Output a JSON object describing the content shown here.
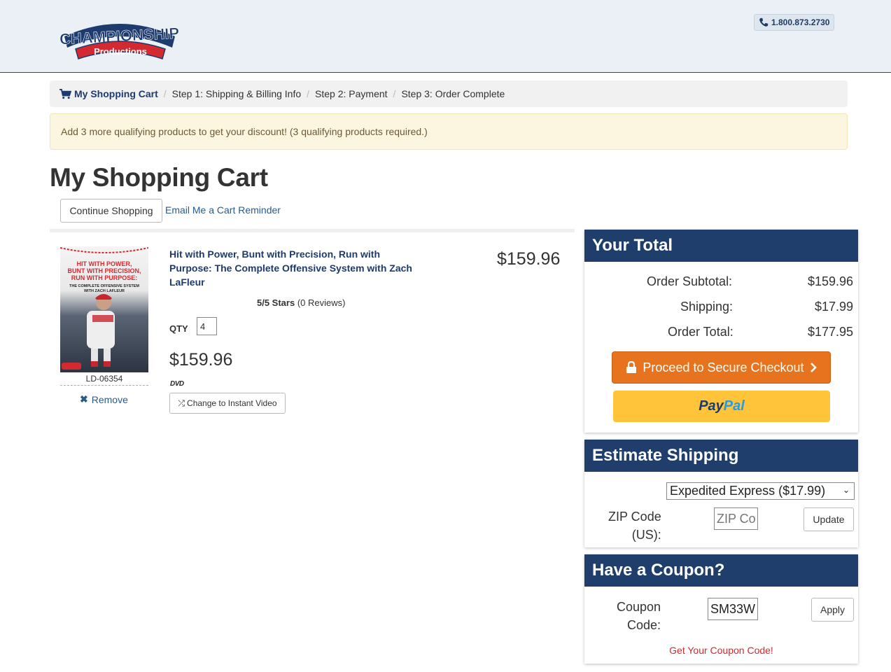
{
  "header": {
    "logo_top": "CHAMPIONSHIP",
    "logo_bottom": "Productions",
    "phone": "1.800.873.2730"
  },
  "breadcrumb": {
    "cart": "My Shopping Cart",
    "step1": "Step 1: Shipping & Billing Info",
    "step2": "Step 2: Payment",
    "step3": "Step 3: Order Complete"
  },
  "alert": "Add 3 more qualifying products to get your discount! (3 qualifying products required.)",
  "page_title": "My Shopping Cart",
  "actions": {
    "continue": "Continue Shopping",
    "email": "Email Me a Cart Reminder"
  },
  "item": {
    "cover_lines": [
      "HIT WITH POWER,",
      "BUNT WITH PRECISION,",
      "RUN WITH PURPOSE:",
      "THE COMPLETE OFFENSIVE SYSTEM",
      "WITH ZACH LAFLEUR"
    ],
    "sku": "LD-06354",
    "remove": "Remove",
    "title": "Hit with Power, Bunt with Precision, Run with Purpose: The Complete Offensive System with Zach LaFleur",
    "price_total": "$159.96",
    "stars_bold": "5/5 Stars",
    "stars_reviews": "(0 Reviews)",
    "qty_label": "QTY",
    "qty": "4",
    "price": "$159.96",
    "format": "DVD",
    "change_label": "Change to Instant Video"
  },
  "total": {
    "heading": "Your Total",
    "subtotal_label": "Order Subtotal:",
    "subtotal": "$159.96",
    "shipping_label": "Shipping:",
    "shipping": "$17.99",
    "order_total_label": "Order Total:",
    "order_total": "$177.95",
    "checkout_label": "Proceed to Secure Checkout",
    "paypal_a": "Pay",
    "paypal_b": "Pal"
  },
  "shipping": {
    "heading": "Estimate Shipping",
    "selected": "Expedited Express ($17.99)",
    "zip_label_1": "ZIP Code",
    "zip_label_2": "(US):",
    "zip_placeholder": "ZIP Co",
    "update": "Update"
  },
  "coupon": {
    "heading": "Have a Coupon?",
    "label_1": "Coupon",
    "label_2": "Code:",
    "value": "SM33W",
    "apply": "Apply",
    "link": "Get Your Coupon Code!"
  },
  "colors": {
    "navy": "#1f3e6b",
    "checkout": "#e8731e",
    "paypal": "#ffc43a",
    "link_red": "#d6262e"
  }
}
